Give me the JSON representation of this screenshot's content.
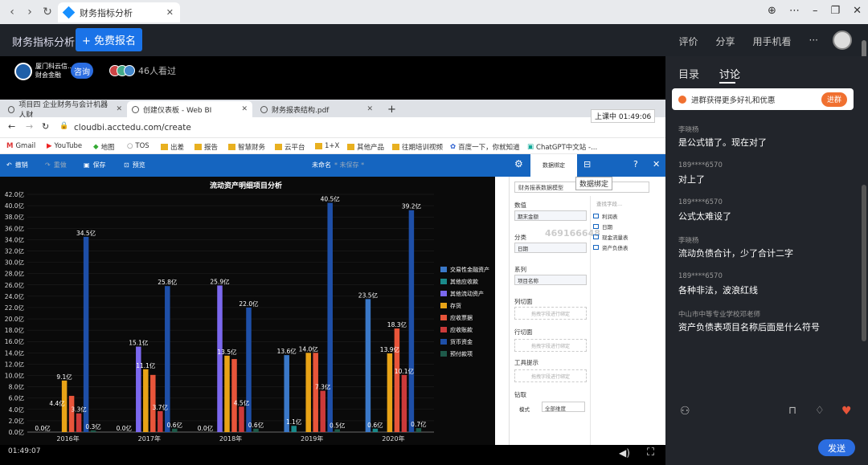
{
  "window": {
    "tab_title": "财务指标分析"
  },
  "header": {
    "course_title": "财务指标分析",
    "signup_label": "+ 免费报名",
    "links": [
      "评价",
      "分享",
      "用手机看",
      "···"
    ]
  },
  "info": {
    "brand_line1": "厦门科云信...",
    "brand_line2": "财会金融",
    "consult_label": "咨询",
    "viewers": "46人看过"
  },
  "browser": {
    "tabs": [
      "项目四 企业财务与会计机器人财",
      "创建仪表板 - Web BI",
      "财务报表结构.pdf"
    ],
    "new_tab": "+",
    "url": "cloudbi.acctedu.com/create",
    "rec_label": "上课中 01:49:06",
    "bookmarks": [
      "Gmail",
      "YouTube",
      "地图",
      "TOS",
      "出差",
      "报告",
      "智慧财务",
      "云平台",
      "1+X",
      "其他产品",
      "往期培训视频",
      "百度一下，你就知道",
      "ChatGPT中文站 -..."
    ],
    "toolbar": {
      "undo": "撤销",
      "redo": "重做",
      "save": "保存",
      "preview": "预览",
      "doc_name": "未命名",
      "doc_status": "* 未保存 *",
      "data_bind": "数据绑定"
    },
    "tooltip": "数据绑定",
    "panel": {
      "model": "财务报表数据模型",
      "value_label": "数值",
      "value_field": "期末金额",
      "category_label": "分类",
      "category_field": "日期",
      "series_label": "系列",
      "series_field": "项目名称",
      "col_label": "列切面",
      "row_label": "行切面",
      "tip_label": "工具提示",
      "drill_label": "钻取",
      "mode_label": "模式",
      "mode_value": "全部维度",
      "drop_hint": "拖拽字段进行绑定",
      "search_hint": "查找字段...",
      "watermark": "469166648",
      "tree": [
        "利润表",
        "日期",
        "现金流量表",
        "资产负债表"
      ]
    }
  },
  "chart_data": {
    "type": "bar",
    "title": "流动资产明细项目分析",
    "xlabel": "",
    "ylabel": "",
    "ylim": [
      0,
      42
    ],
    "unit": "亿",
    "categories": [
      "2016年",
      "2017年",
      "2018年",
      "2019年",
      "2020年"
    ],
    "series": [
      {
        "name": "交易性金融资产",
        "color": "#3a78c8",
        "values": [
          0,
          0,
          0,
          13.6,
          23.5
        ]
      },
      {
        "name": "其他应收款",
        "color": "#1a8a8a",
        "values": [
          0,
          0,
          0,
          1.1,
          0.6
        ]
      },
      {
        "name": "其他流动资产",
        "color": "#7b68ee",
        "values": [
          0,
          15.1,
          25.9,
          0,
          0
        ]
      },
      {
        "name": "存货",
        "color": "#e8a317",
        "values": [
          9.1,
          11.1,
          13.5,
          14.0,
          13.9
        ]
      },
      {
        "name": "应收票据",
        "color": "#e8553a",
        "values": [
          6.4,
          10.1,
          12.9,
          14.0,
          18.3
        ]
      },
      {
        "name": "应收账款",
        "color": "#cc3a3a",
        "values": [
          3.3,
          3.7,
          4.5,
          7.3,
          10.1
        ]
      },
      {
        "name": "货币资金",
        "color": "#1e4fa8",
        "values": [
          34.5,
          25.8,
          22.0,
          40.5,
          39.2
        ]
      },
      {
        "name": "预付款项",
        "color": "#1e5a4a",
        "values": [
          0.3,
          0.6,
          0.6,
          0.5,
          0.7
        ]
      }
    ],
    "labels": [
      [
        "0.0亿",
        "9.1亿",
        "4.4亿",
        "3.3亿",
        "34.5亿",
        "0.3亿"
      ],
      [
        "0.0亿",
        "15.1亿",
        "11.1亿",
        "3.7亿",
        "25.8亿",
        "0.6亿"
      ],
      [
        "0.0亿",
        "25.9亿",
        "13.5亿",
        "4.5亿",
        "22.0亿",
        "0.6亿"
      ],
      [
        "13.6亿",
        "1.1亿",
        "14.0亿",
        "7.3亿",
        "40.5亿",
        "0.5亿"
      ],
      [
        "23.5亿",
        "0.6亿",
        "13.9亿",
        "18.3亿",
        "10.1亿",
        "39.2亿",
        "0.7亿"
      ]
    ],
    "yticks": [
      "0.0亿",
      "2.0亿",
      "4.0亿",
      "6.0亿",
      "8.0亿",
      "10.0亿",
      "12.0亿",
      "14.0亿",
      "16.0亿",
      "18.0亿",
      "20.0亿",
      "22.0亿",
      "24.0亿",
      "26.0亿",
      "28.0亿",
      "30.0亿",
      "32.0亿",
      "34.0亿",
      "36.0亿",
      "38.0亿",
      "40.0亿",
      "42.0亿"
    ]
  },
  "video": {
    "time": "01:49:07"
  },
  "sidebar": {
    "tabs": [
      "目录",
      "讨论"
    ],
    "promo": "进群获得更多好礼和优惠",
    "join": "进群",
    "comments": [
      {
        "name": "李晓杨",
        "text": "是公式错了。现在对了"
      },
      {
        "name": "189****6570",
        "text": "对上了"
      },
      {
        "name": "189****6570",
        "text": "公式太难设了"
      },
      {
        "name": "李晓杨",
        "text": "流动负债合计，少了合计二字"
      },
      {
        "name": "189****6570",
        "text": "各种非法，波浪红线"
      },
      {
        "name": "中山市中等专业学校邓老师",
        "text": "资产负债表项目名称后面是什么符号"
      }
    ],
    "send": "发送"
  }
}
